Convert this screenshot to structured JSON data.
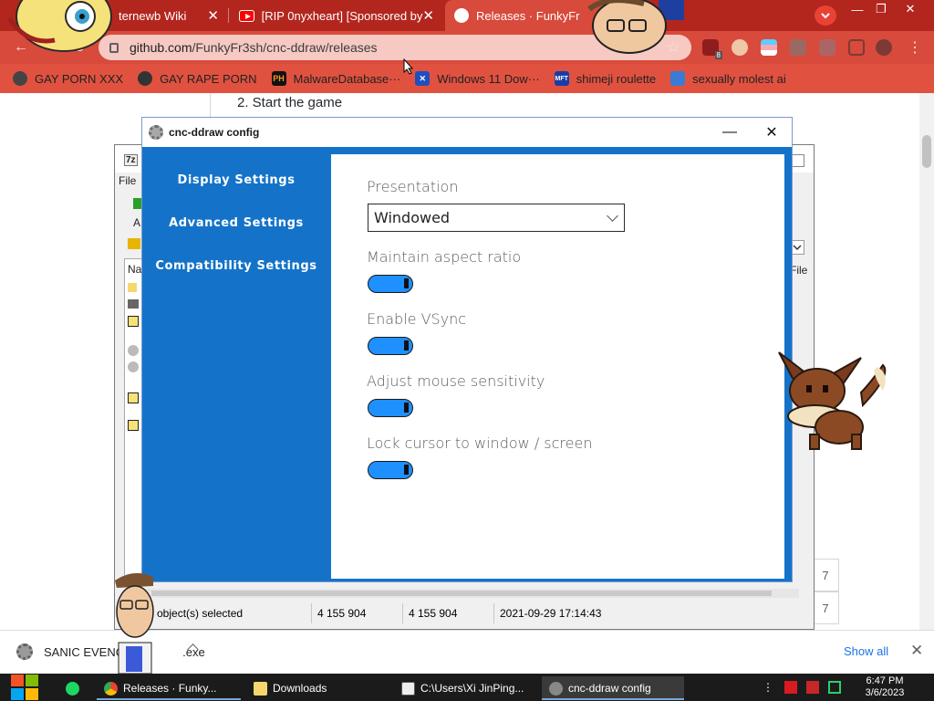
{
  "browser": {
    "tabs": [
      {
        "title": "ternewb Wiki",
        "close": "✕"
      },
      {
        "title": "[RIP 0nyxheart] [Sponsored by",
        "close": "✕"
      },
      {
        "title": "Releases · FunkyFr",
        "close": "✕"
      }
    ],
    "window_controls": {
      "minimize": "—",
      "restore": "❐",
      "close": "✕"
    },
    "address": {
      "domain": "github.com",
      "path": "/FunkyFr3sh/cnc-ddraw/releases"
    },
    "bookmarks": [
      {
        "label": "GAY PORN XXX",
        "icon": "gear-icon"
      },
      {
        "label": "GAY RAPE PORN",
        "icon": "globe-icon"
      },
      {
        "label": "MalwareDatabase···",
        "icon": "ph-icon",
        "icon_text": "PH"
      },
      {
        "label": "Windows 11 Dow···",
        "icon": "x-icon"
      },
      {
        "label": "shimeji roulette",
        "icon": "mft-icon"
      },
      {
        "label": "sexually molest ai",
        "icon": "app-icon"
      }
    ],
    "extension_badge": "8"
  },
  "page": {
    "step": "2. Start the game",
    "right_boxes": [
      "7",
      "7"
    ]
  },
  "zip": {
    "side_labels": [
      "File",
      "A",
      "Na"
    ],
    "file_col": "File",
    "status": {
      "selected": "object(s) selected",
      "size": "4 155 904",
      "packed": "4 155 904",
      "modified": "2021-09-29 17:14:43"
    }
  },
  "config": {
    "title": "cnc-ddraw config",
    "controls": {
      "minimize": "—",
      "close": "✕"
    },
    "nav": [
      "Display Settings",
      "Advanced Settings",
      "Compatibility Settings"
    ],
    "presentation_label": "Presentation",
    "presentation_value": "Windowed",
    "toggles": [
      {
        "label": "Maintain aspect ratio",
        "on": true
      },
      {
        "label": "Enable VSync",
        "on": true
      },
      {
        "label": "Adjust mouse sensitivity",
        "on": true
      },
      {
        "label": "Lock cursor to window / screen",
        "on": true
      }
    ]
  },
  "download_bar": {
    "item": "SANIC EVENC",
    "item_suffix": ".exe",
    "show_all": "Show all",
    "close": "✕"
  },
  "taskbar": {
    "items": [
      {
        "label": "Releases · Funky..."
      },
      {
        "label": "Downloads"
      },
      {
        "label": "C:\\Users\\Xi JinPing..."
      },
      {
        "label": "cnc-ddraw config"
      }
    ],
    "time": "6:47 PM",
    "date": "3/6/2023"
  },
  "colors": {
    "tabstrip": "#b3261e",
    "toolbar": "#d84a3b",
    "config_blue": "#1473c9",
    "toggle_blue": "#1e90ff",
    "link_blue": "#1a73e8"
  }
}
